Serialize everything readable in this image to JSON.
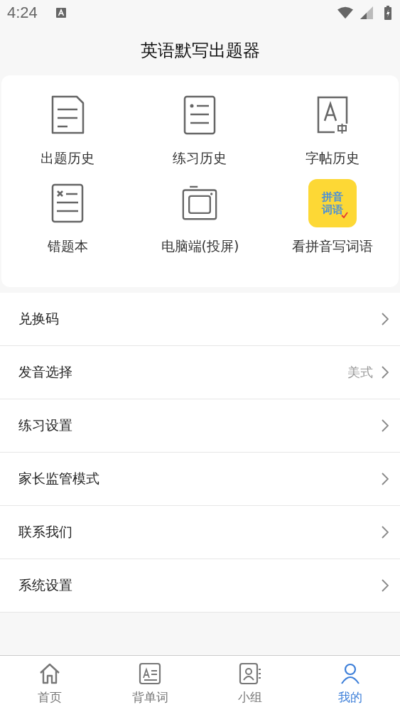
{
  "status_bar": {
    "time": "4:24"
  },
  "header": {
    "title": "英语默写出题器"
  },
  "shortcuts": [
    {
      "label": "出题历史",
      "kind": "document"
    },
    {
      "label": "练习历史",
      "kind": "list"
    },
    {
      "label": "字帖历史",
      "kind": "letter"
    },
    {
      "label": "错题本",
      "kind": "wrong"
    },
    {
      "label": "电脑端(投屏)",
      "kind": "screen"
    },
    {
      "label": "看拼音写词语",
      "kind": "app",
      "badge_lines": [
        "拼音",
        "词语"
      ]
    }
  ],
  "menu": [
    {
      "label": "兑换码"
    },
    {
      "label": "发音选择",
      "value": "美式"
    },
    {
      "label": "练习设置"
    },
    {
      "label": "家长监管模式"
    },
    {
      "label": "联系我们"
    },
    {
      "label": "系统设置"
    }
  ],
  "tabs": [
    {
      "label": "首页",
      "kind": "home",
      "selected": false
    },
    {
      "label": "背单词",
      "kind": "words",
      "selected": false
    },
    {
      "label": "小组",
      "kind": "group",
      "selected": false
    },
    {
      "label": "我的",
      "kind": "me",
      "selected": true
    }
  ]
}
